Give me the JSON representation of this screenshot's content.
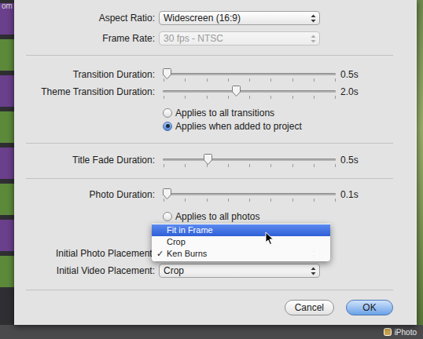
{
  "window": {
    "corner_text": "om",
    "dock_label": "iPhoto"
  },
  "popups": [
    {
      "label": "Aspect Ratio:",
      "value": "Widescreen (16:9)",
      "disabled": false
    },
    {
      "label": "Frame Rate:",
      "value": "30 fps - NTSC",
      "disabled": true
    }
  ],
  "transition_sliders": [
    {
      "label": "Transition Duration:",
      "level": 0,
      "reading": "0.5s"
    },
    {
      "label": "Theme Transition Duration:",
      "level": 0.42,
      "reading": "2.0s"
    }
  ],
  "transition_scope": [
    {
      "label": "Applies to all transitions",
      "selected": false
    },
    {
      "label": "Applies when added to project",
      "selected": true
    }
  ],
  "title_slider": {
    "label": "Title Fade Duration:",
    "level": 0.25,
    "reading": "0.5s"
  },
  "photo_slider": {
    "label": "Photo Duration:",
    "level": 0,
    "reading": "0.1s"
  },
  "photo_scope": [
    {
      "label": "Applies to all photos",
      "selected": false
    }
  ],
  "placements": [
    {
      "label": "Initial Photo Placement:",
      "open": true
    },
    {
      "label": "Initial Video Placement:",
      "open": false,
      "value": "Crop"
    }
  ],
  "placement_menu": {
    "check": "✓",
    "items": [
      {
        "label": "Fit in Frame",
        "highlighted": true,
        "checked": false
      },
      {
        "label": "Crop",
        "highlighted": false,
        "checked": false
      },
      {
        "label": "Ken Burns",
        "highlighted": false,
        "checked": true
      }
    ]
  },
  "buttons": [
    {
      "label": "Cancel",
      "default": false
    },
    {
      "label": "OK",
      "default": true
    }
  ]
}
